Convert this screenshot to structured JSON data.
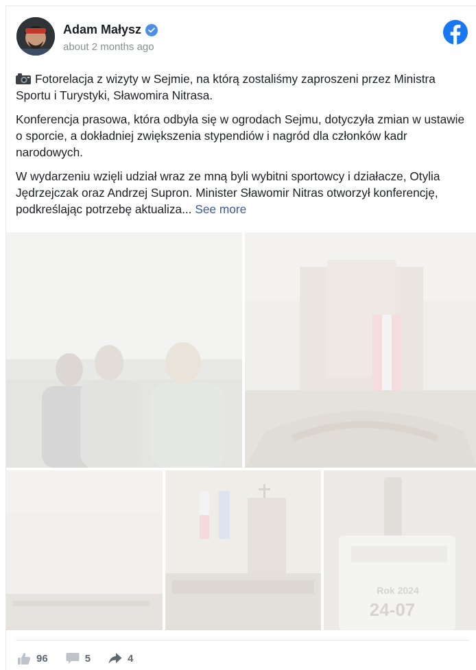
{
  "post": {
    "author": "Adam Małysz",
    "time": "about 2 months ago",
    "paragraph1": "Fotorelacja z wizyty w Sejmie, na którą zostaliśmy zaproszeni przez Ministra Sportu i Turystyki, Sławomira Nitrasa.",
    "paragraph2": "Konferencja prasowa, która odbyła się w ogrodach Sejmu, dotyczyła zmian w ustawie o sporcie, a dokładniej zwiększenia stypendiów i nagród dla członków kadr narodowych.",
    "paragraph3": " W wydarzeniu wzięli udział wraz ze mną byli wybitni sportowcy i działacze, Otylia Jędrzejczak oraz Andrzej Supron. Minister Sławomir Nitras otworzył konferencję, podkreślając potrzebę aktualiza...",
    "see_more": "See more"
  },
  "photos": {
    "badge_year": "Rok 2024",
    "badge_date": "24-07"
  },
  "stats": {
    "likes": "96",
    "comments": "5",
    "shares": "4"
  },
  "icons": {
    "verified": "verified-badge-icon",
    "platform": "facebook-logo-icon",
    "camera": "camera-emoji-icon",
    "like": "like-icon",
    "comment": "comment-icon",
    "share": "share-icon"
  },
  "colors": {
    "brand_blue": "#1877f2",
    "link": "#385898",
    "muted": "#8a8d91"
  }
}
